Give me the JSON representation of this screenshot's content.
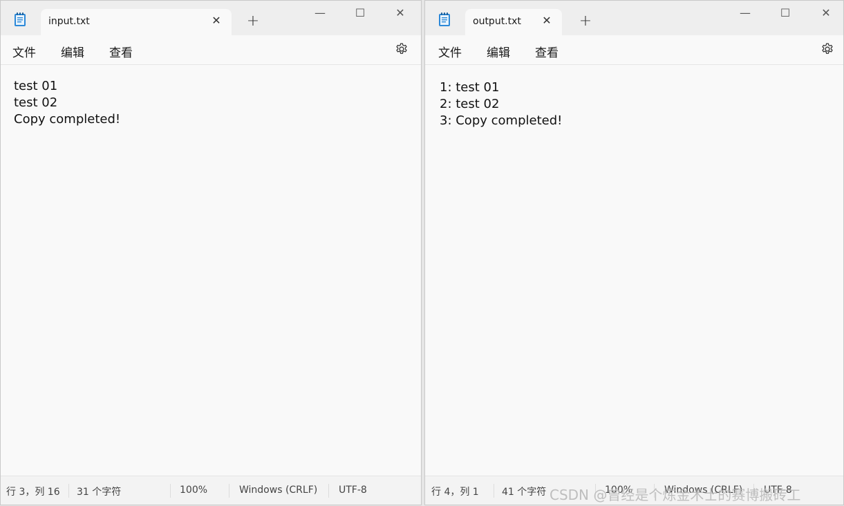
{
  "left_window": {
    "tab_title": "input.txt",
    "menu": [
      "文件",
      "编辑",
      "查看"
    ],
    "lines": [
      "test 01",
      "test 02",
      "Copy completed!"
    ],
    "status": {
      "position": "行 3，列 16",
      "chars": "31 个字符",
      "zoom": "100%",
      "line_ending": "Windows (CRLF)",
      "encoding": "UTF-8"
    }
  },
  "right_window": {
    "tab_title": "output.txt",
    "menu": [
      "文件",
      "编辑",
      "查看"
    ],
    "lines": [
      "1: test 01",
      "2: test 02",
      "3: Copy completed!"
    ],
    "status": {
      "position": "行 4，列 1",
      "chars": "41 个字符",
      "zoom": "100%",
      "line_ending": "Windows (CRLF)",
      "encoding": "UTF-8"
    }
  },
  "watermark": "CSDN @曾经是个炼金术士的赛博搬砖工",
  "colors": {
    "background": "#f9f9f9",
    "titlebar": "#eeeeee",
    "notepad_icon_accent": "#2b88d8"
  }
}
